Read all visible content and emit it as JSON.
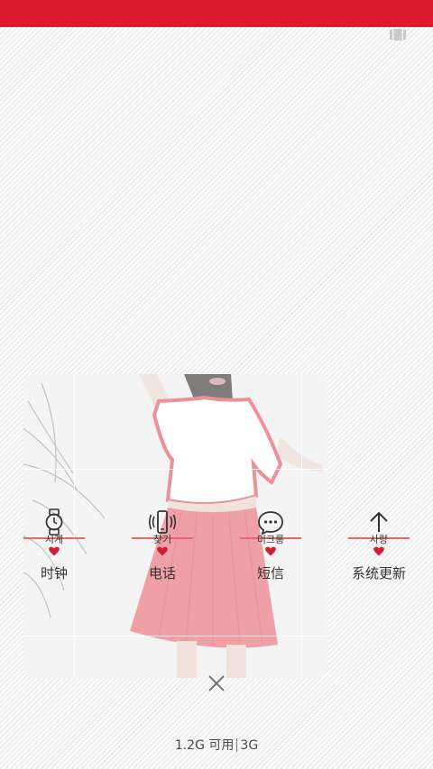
{
  "status_bar": {
    "color": "#dc1a2e"
  },
  "top_right": {
    "icon": "recent-apps-icon"
  },
  "recent_card": {
    "image": "girl-white-tshirt-pink-skirt-photo"
  },
  "apps": [
    {
      "icon": "watch-icon",
      "korean": "시계",
      "label": "时钟"
    },
    {
      "icon": "phone-ringing-icon",
      "korean": "찾기",
      "label": "电话"
    },
    {
      "icon": "chat-bubble-icon",
      "korean": "미크롱",
      "label": "短信"
    },
    {
      "icon": "arrow-up-icon",
      "korean": "사랑",
      "label": "系统更新"
    }
  ],
  "close": {
    "icon": "close-icon"
  },
  "memory": {
    "available": "1.2G 可用",
    "network": "3G"
  },
  "colors": {
    "accent": "#dc1a2e",
    "heart": "#d0202e",
    "skirt": "#e88088"
  }
}
